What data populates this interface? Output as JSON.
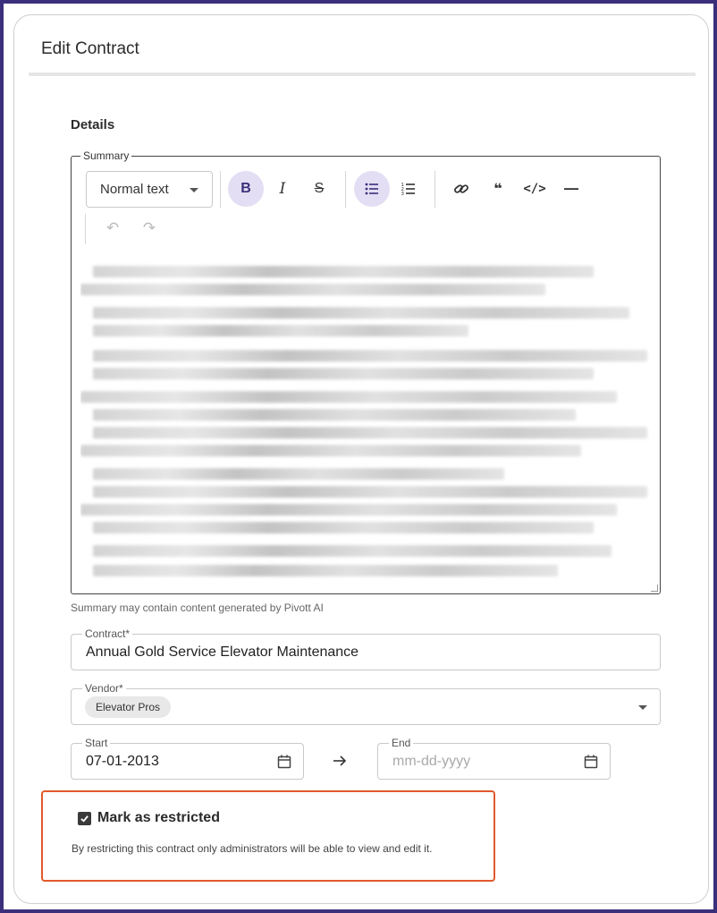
{
  "card": {
    "title": "Edit Contract"
  },
  "details": {
    "section_title": "Details"
  },
  "summary": {
    "legend": "Summary",
    "format_select": "Normal text",
    "toolbar": [
      {
        "name": "bold-icon",
        "glyph": "B",
        "active": true
      },
      {
        "name": "italic-icon",
        "glyph": "I",
        "active": false
      },
      {
        "name": "strikethrough-icon",
        "glyph": "S",
        "active": false
      },
      {
        "name": "bullet-list-icon",
        "active": true
      },
      {
        "name": "numbered-list-icon",
        "active": false
      },
      {
        "name": "link-icon",
        "active": false
      },
      {
        "name": "quote-icon",
        "glyph": "❝",
        "active": false
      },
      {
        "name": "code-icon",
        "glyph": "</>",
        "active": false
      },
      {
        "name": "horizontal-rule-icon",
        "glyph": "—",
        "active": false
      },
      {
        "name": "undo-icon",
        "glyph": "↶",
        "active": false
      },
      {
        "name": "redo-icon",
        "glyph": "↷",
        "active": false
      }
    ],
    "helper_text": "Summary may contain content generated by Pivott AI"
  },
  "contract": {
    "legend": "Contract*",
    "value": "Annual Gold Service Elevator Maintenance"
  },
  "vendor": {
    "legend": "Vendor*",
    "chip": "Elevator Pros"
  },
  "dates": {
    "start_legend": "Start",
    "start_value": "07-01-2013",
    "end_legend": "End",
    "end_placeholder": "mm-dd-yyyy"
  },
  "restricted": {
    "checked": true,
    "label": "Mark as restricted",
    "description": "By restricting this contract only administrators will be able to view and edit it."
  },
  "colors": {
    "accent": "#3a2f7a",
    "active_button_bg": "#e3def3",
    "highlight_border": "#e0592c"
  }
}
